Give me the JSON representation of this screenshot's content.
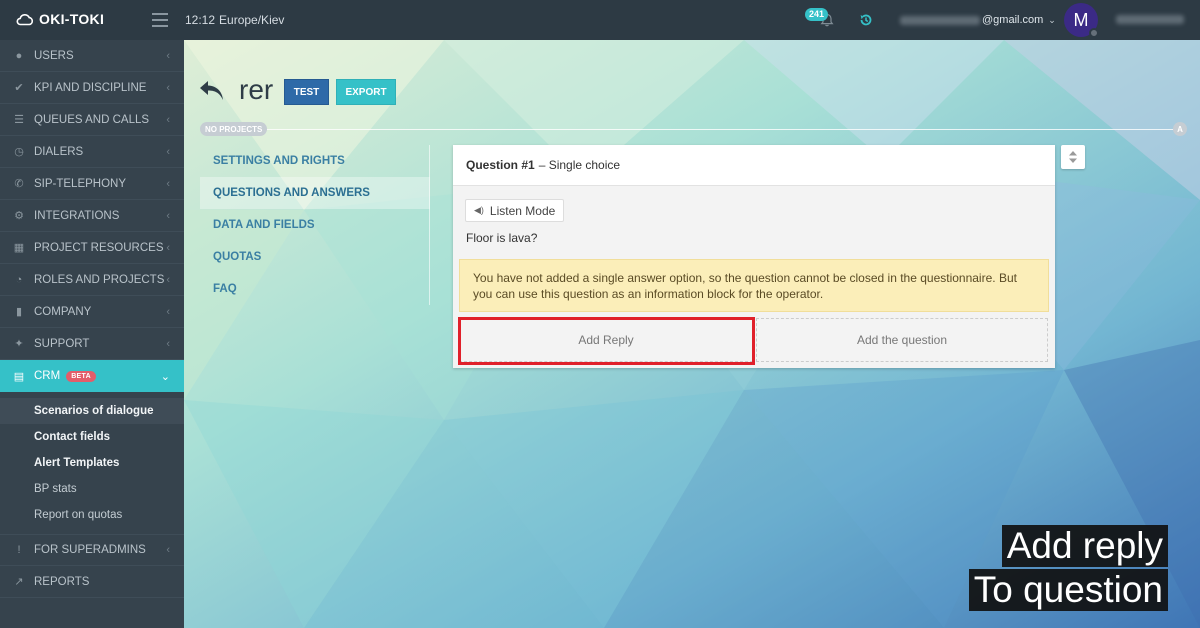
{
  "brand": {
    "logo_text": "OKI-TOKI"
  },
  "topbar": {
    "time": "12:12",
    "timezone": "Europe/Kiev",
    "notifications_count": "241",
    "user_email_suffix": "@gmail.com",
    "avatar_letter": "M"
  },
  "sidebar": {
    "items": [
      {
        "label": "USERS",
        "icon": "user-icon"
      },
      {
        "label": "KPI AND DISCIPLINE",
        "icon": "check-icon"
      },
      {
        "label": "QUEUES AND CALLS",
        "icon": "list-icon"
      },
      {
        "label": "DIALERS",
        "icon": "clock-icon"
      },
      {
        "label": "SIP-TELEPHONY",
        "icon": "phone-icon"
      },
      {
        "label": "INTEGRATIONS",
        "icon": "cogs-icon"
      },
      {
        "label": "PROJECT RESOURCES",
        "icon": "grid-icon"
      },
      {
        "label": "ROLES AND PROJECTS",
        "icon": "toggle-icon"
      },
      {
        "label": "COMPANY",
        "icon": "bar-chart-icon"
      },
      {
        "label": "SUPPORT",
        "icon": "wrench-icon"
      },
      {
        "label": "CRM",
        "icon": "card-icon",
        "badge": "BETA"
      }
    ],
    "crm_subitems": [
      "Scenarios of dialogue",
      "Contact fields",
      "Alert Templates",
      "BP stats",
      "Report on quotas"
    ],
    "bottom_items": [
      {
        "label": "FOR SUPERADMINS",
        "icon": "exclamation-icon"
      },
      {
        "label": "REPORTS",
        "icon": "line-chart-icon"
      }
    ]
  },
  "page": {
    "title": "rer",
    "test_button": "TEST",
    "export_button": "EXPORT",
    "projects_badge": "NO PROJECTS",
    "a_badge": "A"
  },
  "tabs": [
    "SETTINGS AND RIGHTS",
    "QUESTIONS AND ANSWERS",
    "DATA AND FIELDS",
    "QUOTAS",
    "FAQ"
  ],
  "question": {
    "number_label": "Question #1",
    "type_label": "– Single choice",
    "listen_mode": "Listen Mode",
    "text": "Floor is lava?",
    "warning": "You have not added a single answer option, so the question cannot be closed in the questionnaire. But you can use this question as an information block for the operator.",
    "add_reply": "Add Reply",
    "add_question": "Add the question"
  },
  "caption": {
    "line1": "Add reply",
    "line2": "To question"
  },
  "colors": {
    "accent": "#35c1c8",
    "sidebar": "#36434d",
    "topbar": "#2d3a44",
    "primary_button": "#2e6aa8",
    "highlight": "#e0202a"
  }
}
